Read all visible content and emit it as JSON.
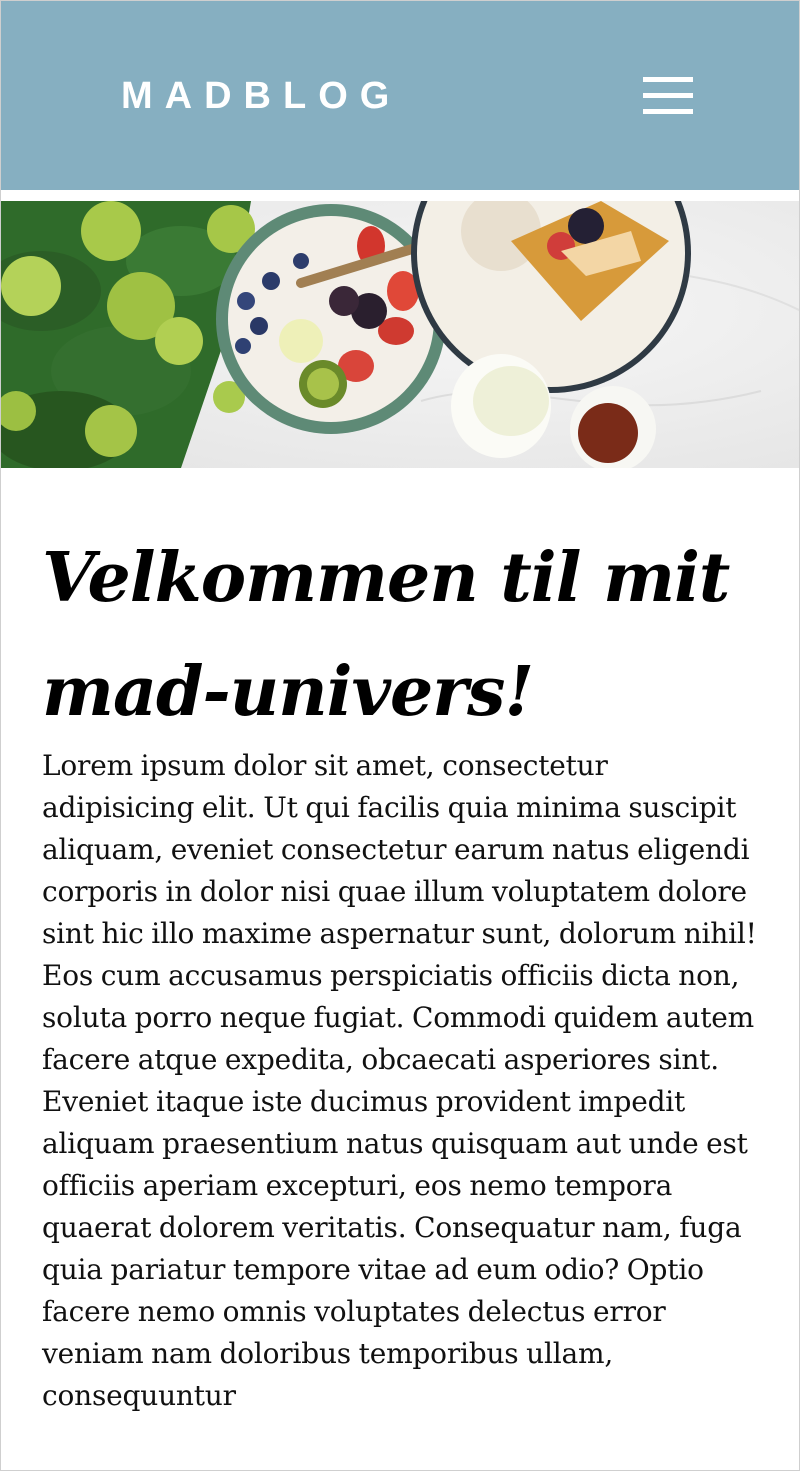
{
  "header": {
    "logo": "MADBLOG",
    "menu_icon": "hamburger-menu-icon"
  },
  "hero": {
    "description_icon": "breakfast-food-photo"
  },
  "main": {
    "title": "Velkommen til mit mad-univers!",
    "body": "Lorem ipsum dolor sit amet, consectetur adipisicing elit. Ut qui facilis quia minima suscipit aliquam, eveniet consectetur earum natus eligendi corporis in dolor nisi quae illum voluptatem dolore sint hic illo maxime aspernatur sunt, dolorum nihil! Eos cum accusamus perspiciatis officiis dicta non, soluta porro neque fugiat. Commodi quidem autem facere atque expedita, obcaecati asperiores sint. Eveniet itaque iste ducimus provident impedit aliquam praesentium natus quisquam aut unde est officiis aperiam excepturi, eos nemo tempora quaerat dolorem veritatis. Consequatur nam, fuga quia pariatur tempore vitae ad eum odio? Optio facere nemo omnis voluptates delectus error veniam nam doloribus temporibus ullam, consequuntur"
  },
  "colors": {
    "header_bg": "#86afc1",
    "logo_text": "#ffffff",
    "body_text": "#111111"
  }
}
